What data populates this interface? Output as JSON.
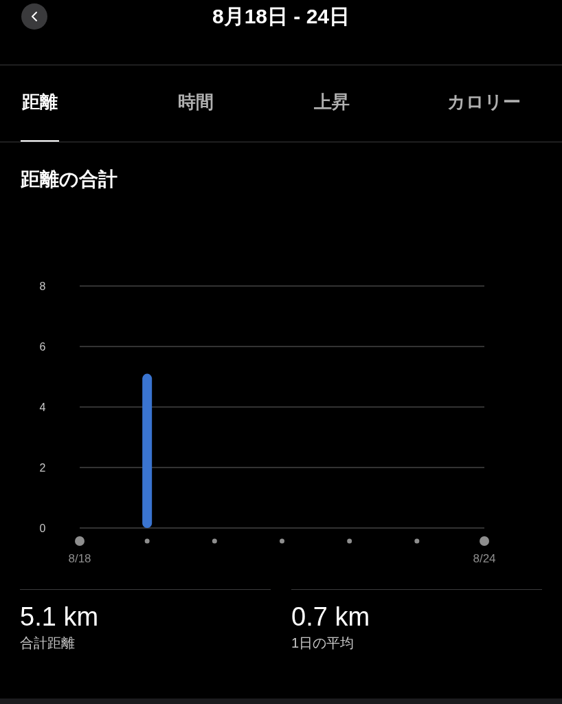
{
  "header": {
    "title": "8月18日 - 24日"
  },
  "tabs": [
    {
      "label": "距離",
      "selected": true
    },
    {
      "label": "時間",
      "selected": false
    },
    {
      "label": "上昇",
      "selected": false
    },
    {
      "label": "カロリー",
      "selected": false
    }
  ],
  "section_title": "距離の合計",
  "chart_data": {
    "type": "bar",
    "categories": [
      "8/18",
      null,
      null,
      null,
      null,
      null,
      "8/24"
    ],
    "values": [
      0,
      5.1,
      0,
      0,
      0,
      0,
      0
    ],
    "ylim": [
      0,
      8
    ],
    "grid": true,
    "yticks": [
      0,
      2,
      4,
      6,
      8
    ]
  },
  "stats": [
    {
      "value": "5.1 km",
      "label": "合計距離"
    },
    {
      "value": "0.7 km",
      "label": "1日の平均"
    }
  ]
}
